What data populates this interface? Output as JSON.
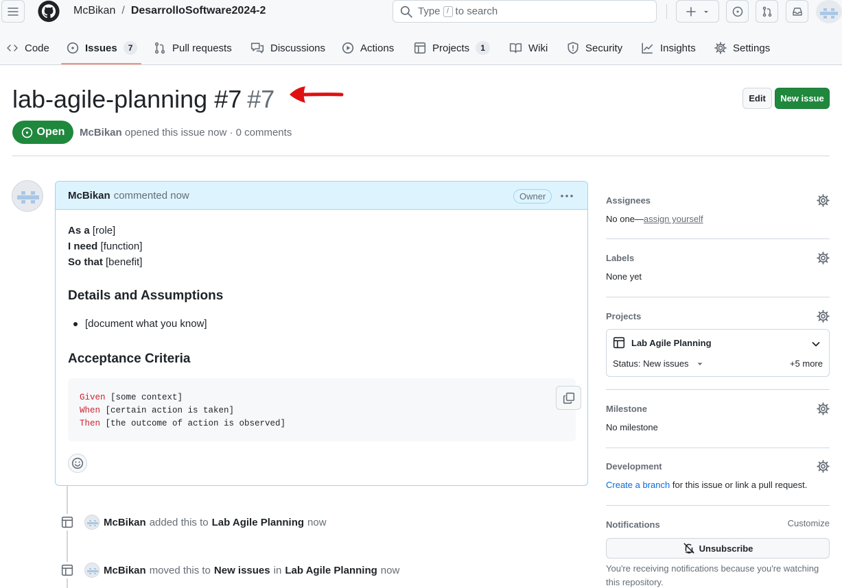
{
  "header": {
    "owner": "McBikan",
    "separator": "/",
    "repo": "DesarrolloSoftware2024-2",
    "search_type": "Type",
    "search_slash": "/",
    "search_rest": "to search"
  },
  "repo_nav": {
    "items": [
      {
        "label": "Code",
        "icon": "code-icon"
      },
      {
        "label": "Issues",
        "icon": "issue-opened-icon",
        "count": "7",
        "selected": true
      },
      {
        "label": "Pull requests",
        "icon": "git-pull-request-icon"
      },
      {
        "label": "Discussions",
        "icon": "comment-discussion-icon"
      },
      {
        "label": "Actions",
        "icon": "play-icon"
      },
      {
        "label": "Projects",
        "icon": "table-icon",
        "count": "1"
      },
      {
        "label": "Wiki",
        "icon": "book-icon"
      },
      {
        "label": "Security",
        "icon": "shield-icon"
      },
      {
        "label": "Insights",
        "icon": "graph-icon"
      },
      {
        "label": "Settings",
        "icon": "gear-icon"
      }
    ],
    "selected_color": "#fd8c73"
  },
  "issue": {
    "title": "lab-agile-planning #7",
    "number": "#7",
    "edit_label": "Edit",
    "new_issue_label": "New issue",
    "state": "Open",
    "author": "McBikan",
    "meta_text": "opened this issue now · 0 comments",
    "state_color": "#1f883d"
  },
  "comment": {
    "author": "McBikan",
    "time": "commented now",
    "badge": "Owner",
    "lines": [
      {
        "bold": "As a",
        "rest": " [role]"
      },
      {
        "bold": "I need",
        "rest": " [function]"
      },
      {
        "bold": "So that",
        "rest": " [benefit]"
      }
    ],
    "section1": "Details and Assumptions",
    "bullet": "[document what you know]",
    "section2": "Acceptance Criteria",
    "code": [
      {
        "kw": "Given",
        "rest": " [some context]"
      },
      {
        "kw": "When",
        "rest": " [certain action is taken]"
      },
      {
        "kw": "Then",
        "rest": " [the outcome of action is observed]"
      }
    ]
  },
  "timeline": {
    "event1": {
      "actor": "McBikan",
      "verb": "added this to",
      "project": "Lab Agile Planning",
      "time": "now"
    },
    "event2": {
      "actor": "McBikan",
      "verb": "moved this to",
      "column": "New issues",
      "in": "in",
      "project": "Lab Agile Planning",
      "time": "now"
    }
  },
  "sidebar": {
    "assignees": {
      "heading": "Assignees",
      "none": "No one—",
      "link": "assign yourself"
    },
    "labels": {
      "heading": "Labels",
      "value": "None yet"
    },
    "projects": {
      "heading": "Projects",
      "name": "Lab Agile Planning",
      "status": "Status: New issues",
      "more": "+5 more"
    },
    "milestone": {
      "heading": "Milestone",
      "value": "No milestone"
    },
    "development": {
      "heading": "Development",
      "link": "Create a branch",
      "rest": " for this issue or link a pull request."
    },
    "notifications": {
      "heading": "Notifications",
      "customize": "Customize",
      "button": "Unsubscribe",
      "note": "You're receiving notifications because you're watching this repository."
    }
  }
}
